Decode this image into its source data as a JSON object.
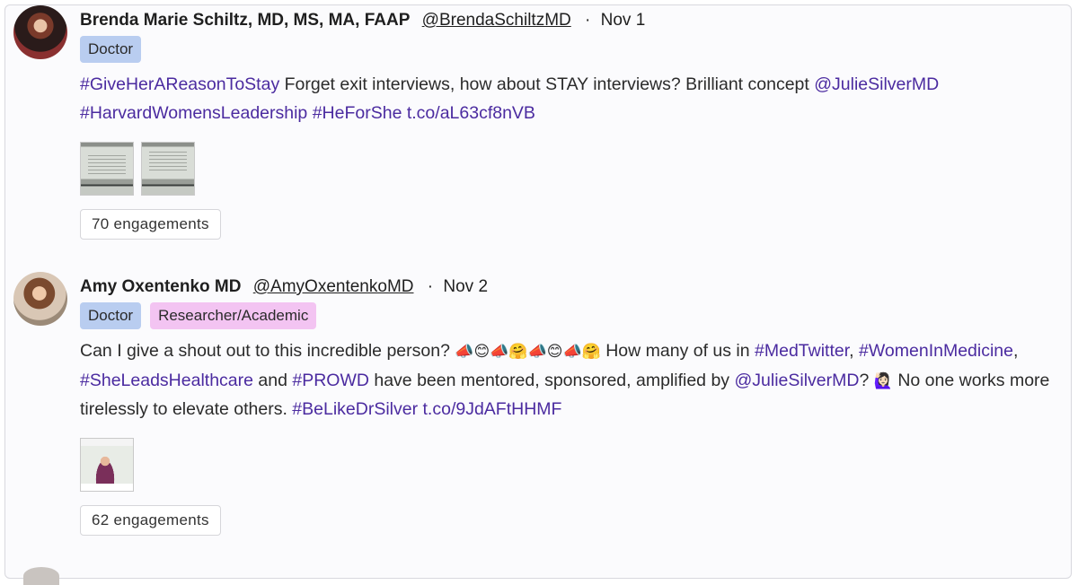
{
  "posts": [
    {
      "author": "Brenda Marie Schiltz, MD, MS, MA, FAAP",
      "handle": "@BrendaSchiltzMD",
      "separator": "·",
      "date": "Nov 1",
      "tags": [
        "Doctor"
      ],
      "text": [
        {
          "t": "#GiveHerAReasonToStay",
          "link": true
        },
        {
          "t": " Forget exit interviews, how about STAY interviews? Brilliant concept ",
          "link": false
        },
        {
          "t": "@JulieSilverMD",
          "link": true
        },
        {
          "t": " ",
          "link": false
        },
        {
          "t": "#HarvardWomensLeadership",
          "link": true
        },
        {
          "t": " ",
          "link": false
        },
        {
          "t": "#HeForShe",
          "link": true
        },
        {
          "t": " ",
          "link": false
        },
        {
          "t": "t.co/aL63cf8nVB",
          "link": true
        }
      ],
      "engagements": "70 engagements"
    },
    {
      "author": "Amy Oxentenko MD",
      "handle": "@AmyOxentenkoMD",
      "separator": "·",
      "date": "Nov 2",
      "tags": [
        "Doctor",
        "Researcher/Academic"
      ],
      "text": [
        {
          "t": "Can I give a shout out to this incredible person? ",
          "link": false
        },
        {
          "t": "📣😊📣🤗📣😊📣🤗",
          "link": false,
          "emoji": true
        },
        {
          "t": " How many of us in ",
          "link": false
        },
        {
          "t": "#MedTwitter",
          "link": true
        },
        {
          "t": ", ",
          "link": false
        },
        {
          "t": "#WomenInMedicine",
          "link": true
        },
        {
          "t": ", ",
          "link": false
        },
        {
          "t": "#SheLeadsHealthcare",
          "link": true
        },
        {
          "t": " and ",
          "link": false
        },
        {
          "t": "#PROWD",
          "link": true
        },
        {
          "t": " have been mentored, sponsored, amplified by ",
          "link": false
        },
        {
          "t": "@JulieSilverMD",
          "link": true
        },
        {
          "t": "? ",
          "link": false
        },
        {
          "t": "🙋🏻‍♀️",
          "link": false,
          "emoji": true
        },
        {
          "t": " No one works more tirelessly to elevate others. ",
          "link": false
        },
        {
          "t": "#BeLikeDrSilver",
          "link": true
        },
        {
          "t": " ",
          "link": false
        },
        {
          "t": "t.co/9JdAFtHHMF",
          "link": true
        }
      ],
      "engagements": "62 engagements"
    }
  ],
  "colors": {
    "link": "#4b2ba0",
    "tag_doctor": "#b9cdf0",
    "tag_researcher": "#f3c4f2"
  }
}
